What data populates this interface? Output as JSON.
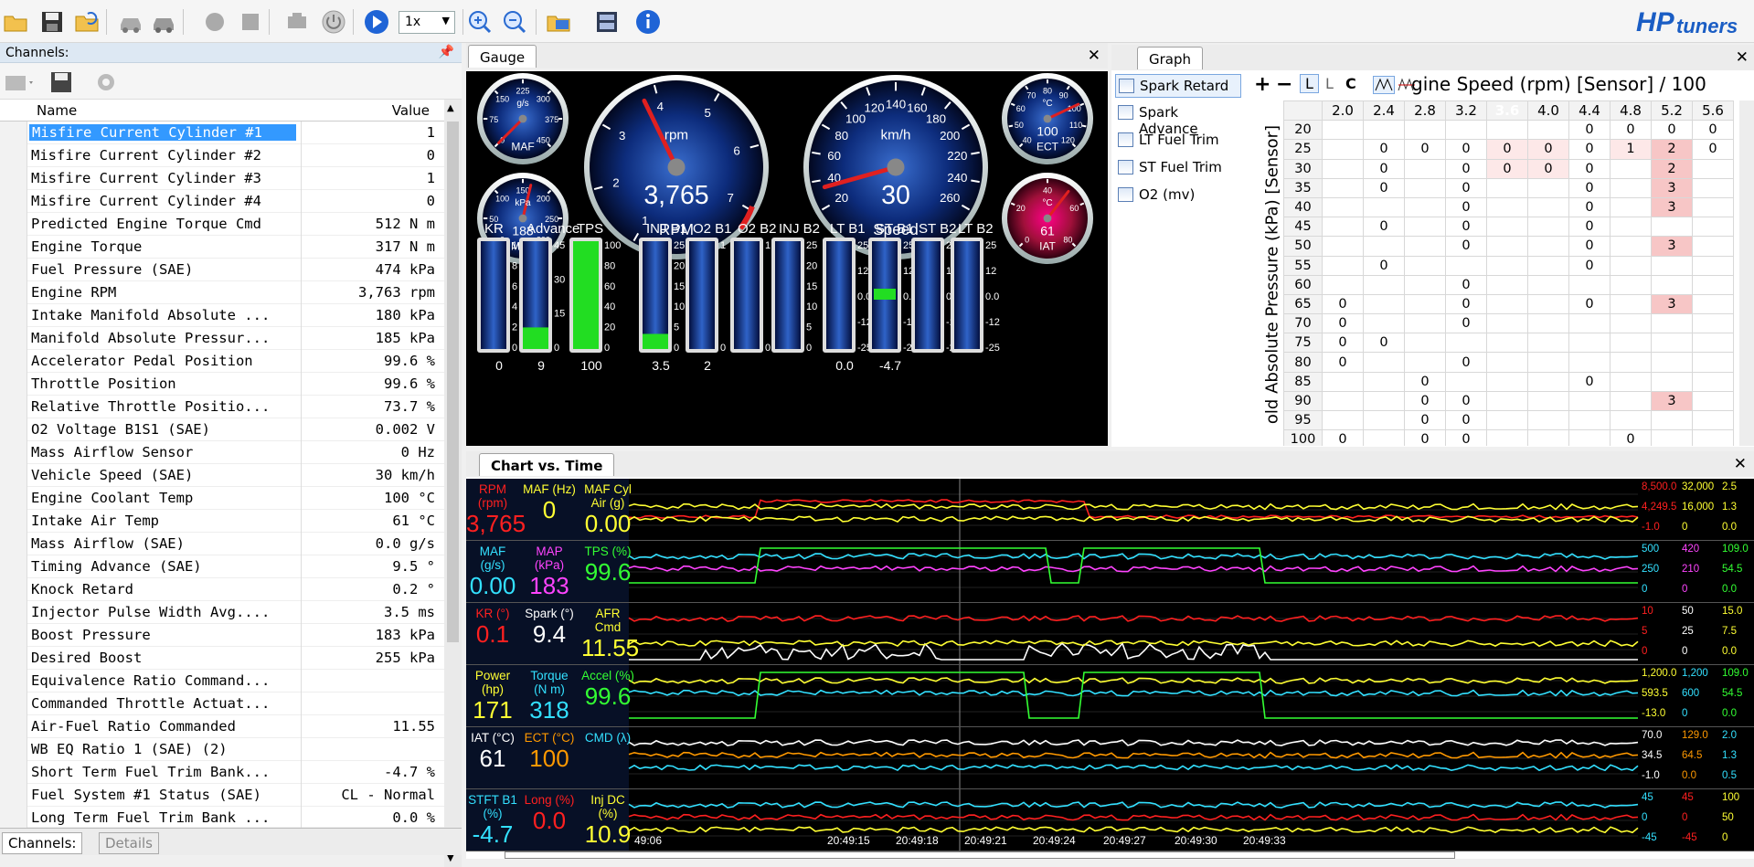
{
  "app": {
    "logo": "HPtuners"
  },
  "toolbar": {
    "speed": "1x",
    "icons": [
      "open-folder-icon",
      "save-icon",
      "open-recent-icon",
      "vehicle-connect-icon",
      "vehicle-disconnect-icon",
      "record-icon",
      "stop-icon",
      "engine-icon",
      "power-icon",
      "play-icon",
      "zoom-in-icon",
      "zoom-out-icon",
      "layout-icon",
      "display-icon",
      "info-icon"
    ]
  },
  "channels": {
    "title": "Channels:",
    "col_name": "Name",
    "col_value": "Value",
    "rows": [
      {
        "name": "Misfire Current Cylinder #1",
        "value": "1"
      },
      {
        "name": "Misfire Current Cylinder #2",
        "value": "0"
      },
      {
        "name": "Misfire Current Cylinder #3",
        "value": "1"
      },
      {
        "name": "Misfire Current Cylinder #4",
        "value": "0"
      },
      {
        "name": "Predicted Engine Torque Cmd",
        "value": "512 N m"
      },
      {
        "name": "Engine Torque",
        "value": "317 N m"
      },
      {
        "name": "Fuel Pressure (SAE)",
        "value": "474 kPa"
      },
      {
        "name": "Engine RPM",
        "value": "3,763 rpm"
      },
      {
        "name": "Intake Manifold Absolute ...",
        "value": "180 kPa"
      },
      {
        "name": "Manifold Absolute Pressur...",
        "value": "185 kPa"
      },
      {
        "name": "Accelerator Pedal Position",
        "value": "99.6 %"
      },
      {
        "name": "Throttle Position",
        "value": "99.6 %"
      },
      {
        "name": "Relative Throttle Positio...",
        "value": "73.7 %"
      },
      {
        "name": "O2 Voltage B1S1 (SAE)",
        "value": "0.002 V"
      },
      {
        "name": "Mass Airflow Sensor",
        "value": "0 Hz"
      },
      {
        "name": "Vehicle Speed (SAE)",
        "value": "30 km/h"
      },
      {
        "name": "Engine Coolant Temp",
        "value": "100 °C"
      },
      {
        "name": "Intake Air Temp",
        "value": "61 °C"
      },
      {
        "name": "Mass Airflow (SAE)",
        "value": "0.0 g/s"
      },
      {
        "name": "Timing Advance (SAE)",
        "value": "9.5 °"
      },
      {
        "name": "Knock Retard",
        "value": "0.2 °"
      },
      {
        "name": "Injector Pulse Width Avg....",
        "value": "3.5 ms"
      },
      {
        "name": "Boost Pressure",
        "value": "183 kPa"
      },
      {
        "name": "Desired Boost",
        "value": "255 kPa"
      },
      {
        "name": "Equivalence Ratio Command...",
        "value": ""
      },
      {
        "name": "Commanded Throttle Actuat...",
        "value": ""
      },
      {
        "name": "Air-Fuel Ratio Commanded",
        "value": "11.55"
      },
      {
        "name": "WB EQ Ratio 1 (SAE) (2)",
        "value": ""
      },
      {
        "name": "Short Term Fuel Trim Bank...",
        "value": "-4.7 %"
      },
      {
        "name": "Fuel System #1 Status (SAE)",
        "value": "CL - Normal"
      },
      {
        "name": "Long Term Fuel Trim Bank ...",
        "value": "0.0 %"
      }
    ],
    "tab_channels": "Channels:",
    "tab_details": "Details"
  },
  "gauge": {
    "tab": "Gauge",
    "maf": {
      "unit": "g/s",
      "label": "MAF",
      "ticks": [
        "0",
        "75",
        "150",
        "225",
        "300",
        "375",
        "450"
      ]
    },
    "map": {
      "unit": "kPa",
      "label": "MAP",
      "value": "183",
      "ticks": [
        "0",
        "50",
        "100",
        "150",
        "200",
        "250",
        "300"
      ]
    },
    "rpm": {
      "unit": "rpm",
      "label": "RPM",
      "value": "3,765",
      "ticks": [
        "1",
        "2",
        "3",
        "4",
        "5",
        "6",
        "7"
      ]
    },
    "speed": {
      "unit": "km/h",
      "label": "Speed",
      "value": "30",
      "ticks": [
        "20",
        "40",
        "60",
        "80",
        "100",
        "120",
        "140",
        "160",
        "180",
        "200",
        "220",
        "240",
        "260"
      ]
    },
    "ect": {
      "unit": "°C",
      "label": "ECT",
      "value": "100",
      "ticks": [
        "40",
        "50",
        "60",
        "70",
        "80",
        "90",
        "100",
        "110",
        "120"
      ]
    },
    "iat": {
      "unit": "°C",
      "label": "IAT",
      "value": "61",
      "ticks": [
        "0",
        "20",
        "40",
        "60",
        "80"
      ]
    },
    "bars": [
      {
        "label": "KR",
        "value": "0",
        "ticks": [
          "10",
          "8",
          "6",
          "4",
          "2",
          "0"
        ],
        "fill": 0
      },
      {
        "label": "Advance",
        "value": "9",
        "ticks": [
          "45",
          "30",
          "15",
          "0"
        ],
        "fill": 0.2
      },
      {
        "label": "TPS",
        "value": "100",
        "ticks": [
          "100",
          "80",
          "60",
          "40",
          "20",
          "0"
        ],
        "fill": 1.0
      },
      {
        "label": "INJ B1",
        "value": "3.5",
        "ticks": [
          "25",
          "20",
          "15",
          "10",
          "5",
          "0"
        ],
        "fill": 0.14
      },
      {
        "label": "O2 B1",
        "value": "2",
        "ticks": [
          "1",
          "0"
        ],
        "fill": 0
      },
      {
        "label": "O2 B2",
        "value": "",
        "ticks": [
          "1",
          "0"
        ],
        "fill": 0
      },
      {
        "label": "INJ B2",
        "value": "",
        "ticks": [
          "25",
          "20",
          "15",
          "10",
          "5",
          "0"
        ],
        "fill": 0
      },
      {
        "label": "LT B1",
        "value": "0.0",
        "ticks": [
          "25",
          "12",
          "0.0",
          "-12",
          "-25"
        ],
        "fill": 0
      },
      {
        "label": "ST B1",
        "value": "-4.7",
        "ticks": [
          "25",
          "12",
          "0.0",
          "-12",
          "-25"
        ],
        "fill": 0
      },
      {
        "label": "ST B2",
        "value": "",
        "ticks": [
          "25",
          "12",
          "0.0",
          "-12",
          "-25"
        ],
        "fill": 0
      },
      {
        "label": "LT B2",
        "value": "",
        "ticks": [
          "25",
          "12",
          "0.0",
          "-12",
          "-25"
        ],
        "fill": 0
      }
    ]
  },
  "graph": {
    "tab": "Graph",
    "items": [
      "Spark Retard",
      "Spark Advance",
      "LT Fuel Trim",
      "ST Fuel Trim",
      "O2 (mv)"
    ],
    "tools": [
      "+",
      "−",
      "L",
      "L",
      "C"
    ],
    "title": "gine Speed (rpm) [Sensor] / 100",
    "ylabel": "old Absolute Pressure (kPa) [Sensor]",
    "cols": [
      "2.0",
      "2.4",
      "2.8",
      "3.2",
      "3.6",
      "4.0",
      "4.4",
      "4.8",
      "5.2",
      "5.6"
    ],
    "rows": [
      {
        "h": "20",
        "c": [
          "",
          "",
          "",
          "",
          "",
          "",
          "0",
          "0",
          "0",
          "0"
        ]
      },
      {
        "h": "25",
        "c": [
          "",
          "0",
          "0",
          "0",
          "0",
          "0",
          "0",
          "1",
          "2",
          "0"
        ]
      },
      {
        "h": "30",
        "c": [
          "",
          "0",
          "",
          "0",
          "0",
          "0",
          "0",
          "",
          "2",
          ""
        ]
      },
      {
        "h": "35",
        "c": [
          "",
          "0",
          "",
          "0",
          "",
          "",
          "0",
          "",
          "3",
          ""
        ]
      },
      {
        "h": "40",
        "c": [
          "",
          "",
          "",
          "0",
          "",
          "",
          "0",
          "",
          "3",
          ""
        ]
      },
      {
        "h": "45",
        "c": [
          "",
          "0",
          "",
          "0",
          "",
          "",
          "0",
          "",
          "",
          ""
        ]
      },
      {
        "h": "50",
        "c": [
          "",
          "",
          "",
          "0",
          "",
          "",
          "0",
          "",
          "3",
          ""
        ]
      },
      {
        "h": "55",
        "c": [
          "",
          "0",
          "",
          "",
          "",
          "",
          "0",
          "",
          "",
          ""
        ]
      },
      {
        "h": "60",
        "c": [
          "",
          "",
          "",
          "0",
          "",
          "",
          "",
          "",
          "",
          ""
        ]
      },
      {
        "h": "65",
        "c": [
          "0",
          "",
          "",
          "0",
          "",
          "",
          "0",
          "",
          "3",
          ""
        ]
      },
      {
        "h": "70",
        "c": [
          "0",
          "",
          "",
          "0",
          "",
          "",
          "",
          "",
          "",
          ""
        ]
      },
      {
        "h": "75",
        "c": [
          "0",
          "0",
          "",
          "",
          "",
          "",
          "",
          "",
          "",
          ""
        ]
      },
      {
        "h": "80",
        "c": [
          "0",
          "",
          "",
          "0",
          "",
          "",
          "",
          "",
          "",
          ""
        ]
      },
      {
        "h": "85",
        "c": [
          "",
          "",
          "0",
          "",
          "",
          "",
          "0",
          "",
          "",
          ""
        ]
      },
      {
        "h": "90",
        "c": [
          "",
          "",
          "0",
          "0",
          "",
          "",
          "",
          "",
          "3",
          ""
        ]
      },
      {
        "h": "95",
        "c": [
          "",
          "",
          "0",
          "0",
          "",
          "",
          "",
          "",
          "",
          ""
        ]
      },
      {
        "h": "100",
        "c": [
          "0",
          "",
          "0",
          "0",
          "",
          "",
          "",
          "0",
          "",
          ""
        ]
      }
    ]
  },
  "chart": {
    "tab": "Chart vs. Time",
    "strips": [
      {
        "labels": [
          {
            "t": "RPM (rpm)",
            "v": "3,765",
            "c": "#ff2020"
          },
          {
            "t": "MAF (Hz)",
            "v": "0",
            "c": "#ffff33"
          },
          {
            "t": "MAF Cyl Air (g)",
            "v": "0.00",
            "c": "#ffff33"
          }
        ],
        "scale": [
          [
            "8,500.0",
            "32,000",
            "2.5"
          ],
          [
            "4,249.5",
            "16,000",
            "1.3"
          ],
          [
            "-1.0",
            "0",
            "0.0"
          ]
        ],
        "scolor": [
          "#ff2020",
          "#ffff33",
          "#ffff33"
        ]
      },
      {
        "labels": [
          {
            "t": "MAF (g/s)",
            "v": "0.00",
            "c": "#33e0ff"
          },
          {
            "t": "MAP (kPa)",
            "v": "183",
            "c": "#ff44ff"
          },
          {
            "t": "TPS (%)",
            "v": "99.6",
            "c": "#33ff33"
          }
        ],
        "scale": [
          [
            "500",
            "420",
            "109.0"
          ],
          [
            "250",
            "210",
            "54.5"
          ],
          [
            "0",
            "0",
            "0.0"
          ]
        ],
        "scolor": [
          "#33e0ff",
          "#ff44ff",
          "#33ff33"
        ]
      },
      {
        "labels": [
          {
            "t": "KR (°)",
            "v": "0.1",
            "c": "#ff2020"
          },
          {
            "t": "Spark (°)",
            "v": "9.4",
            "c": "#ffffff"
          },
          {
            "t": "AFR Cmd",
            "v": "11.55",
            "c": "#ffff33"
          }
        ],
        "scale": [
          [
            "10",
            "50",
            "15.0"
          ],
          [
            "5",
            "25",
            "7.5"
          ],
          [
            "0",
            "0",
            "0.0"
          ]
        ],
        "scolor": [
          "#ff2020",
          "#ffffff",
          "#ffff33"
        ]
      },
      {
        "labels": [
          {
            "t": "Power (hp)",
            "v": "171",
            "c": "#ffff33"
          },
          {
            "t": "Torque (N m)",
            "v": "318",
            "c": "#33e0ff"
          },
          {
            "t": "Accel (%)",
            "v": "99.6",
            "c": "#33ff33"
          }
        ],
        "scale": [
          [
            "1,200.0",
            "1,200",
            "109.0"
          ],
          [
            "593.5",
            "600",
            "54.5"
          ],
          [
            "-13.0",
            "0",
            "0.0"
          ]
        ],
        "scolor": [
          "#ffff33",
          "#33e0ff",
          "#33ff33"
        ]
      },
      {
        "labels": [
          {
            "t": "IAT (°C)",
            "v": "61",
            "c": "#ffffff"
          },
          {
            "t": "ECT (°C)",
            "v": "100",
            "c": "#ff9900"
          },
          {
            "t": "CMD (λ)",
            "v": "",
            "c": "#33e0ff"
          }
        ],
        "scale": [
          [
            "70.0",
            "129.0",
            "2.0"
          ],
          [
            "34.5",
            "64.5",
            "1.3"
          ],
          [
            "-1.0",
            "0.0",
            "0.5"
          ]
        ],
        "scolor": [
          "#ffffff",
          "#ff9900",
          "#33e0ff"
        ]
      },
      {
        "labels": [
          {
            "t": "STFT B1 (%)",
            "v": "-4.7",
            "c": "#33e0ff"
          },
          {
            "t": "Long (%)",
            "v": "0.0",
            "c": "#ff2020"
          },
          {
            "t": "Inj DC (%)",
            "v": "10.9",
            "c": "#ffff33"
          }
        ],
        "scale": [
          [
            "45",
            "45",
            "100"
          ],
          [
            "0",
            "0",
            "50"
          ],
          [
            "-45",
            "-45",
            "0"
          ]
        ],
        "scolor": [
          "#33e0ff",
          "#ff2020",
          "#ffff33"
        ]
      }
    ],
    "times": [
      "49:06",
      "20:49:15",
      "20:49:18",
      "20:49:21",
      "20:49:24",
      "20:49:27",
      "20:49:30",
      "20:49:33"
    ]
  },
  "colors": {
    "highlight": "#3399ff",
    "dark": "#000000"
  }
}
